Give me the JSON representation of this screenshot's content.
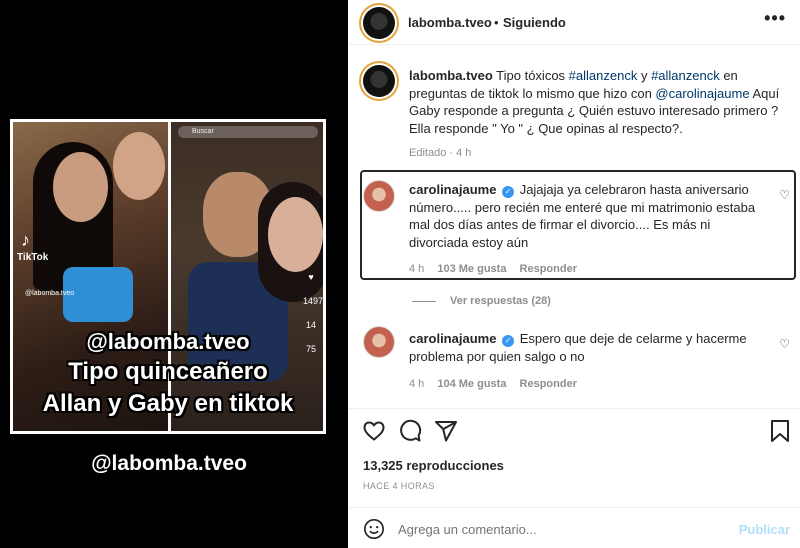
{
  "media": {
    "search_placeholder": "Buscar",
    "tiktok_label": "TikTok",
    "tiktok_handle": "@labomba.tveo",
    "overlay_lines": [
      "@labomba.tveo",
      "Tipo quinceañero",
      "Allan y Gaby en tiktok"
    ],
    "below_handle": "@labomba.tveo",
    "side_counts": [
      "1497",
      "14",
      "75"
    ]
  },
  "header": {
    "username": "labomba.tveo",
    "separator": "•",
    "follow_status": "Siguiendo",
    "more_icon": "more-horizontal-icon"
  },
  "caption": {
    "username": "labomba.tveo",
    "text_1": " Tipo tóxicos ",
    "tag_1": "#allanzenck",
    "text_2": " y ",
    "tag_2": "#allanzenck",
    "text_3": " en preguntas de tiktok lo mismo que hizo con ",
    "mention": "@carolinajaume",
    "text_4": " Aquí Gaby responde a pregunta ¿ Quién estuvo interesado primero ? Ella responde \" Yo \" ¿ Que opinas al respecto?.",
    "meta": "Editado · 4 h"
  },
  "comments": [
    {
      "username": "carolinajaume",
      "text": "Jajajaja ya celebraron hasta aniversario número..... pero recién me enteré que mi matrimonio estaba mal dos días antes de firmar el divorcio.... Es más ni divorciada estoy aún",
      "time": "4 h",
      "likes": "103 Me gusta",
      "reply": "Responder"
    },
    {
      "username": "carolinajaume",
      "text": "Espero que deje de celarme y hacerme problema por quien salgo o no",
      "time": "4 h",
      "likes": "104 Me gusta",
      "reply": "Responder"
    }
  ],
  "view_replies": "Ver respuestas (28)",
  "stats": {
    "views": "13,325 reproducciones",
    "posted": "HACE 4 HORAS"
  },
  "add_comment": {
    "placeholder": "Agrega un comentario...",
    "publish": "Publicar"
  },
  "colors": {
    "link": "#00376b",
    "verified": "#3897f0",
    "muted": "#8e8e8e",
    "publish_disabled": "#b2dffc"
  }
}
